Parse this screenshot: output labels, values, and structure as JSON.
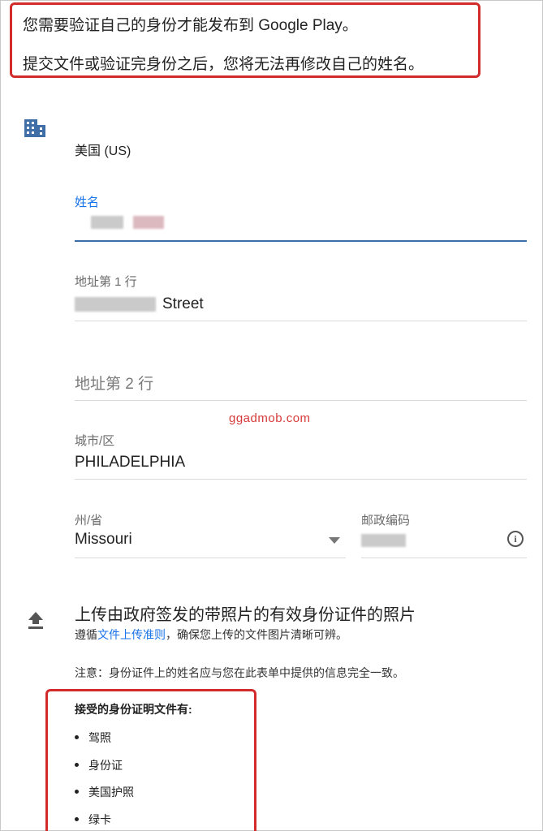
{
  "notice": {
    "line1": "您需要验证自己的身份才能发布到 Google Play。",
    "line2": "提交文件或验证完身份之后，您将无法再修改自己的姓名。"
  },
  "form": {
    "country": "美国 (US)",
    "name": {
      "label": "姓名",
      "value": ""
    },
    "address1": {
      "label": "地址第 1 行",
      "value_suffix": "Street"
    },
    "address2": {
      "placeholder": "地址第 2 行"
    },
    "city": {
      "label": "城市/区",
      "value": "PHILADELPHIA"
    },
    "state": {
      "label": "州/省",
      "value": "Missouri"
    },
    "postal": {
      "label": "邮政编码",
      "value": ""
    }
  },
  "watermark": "ggadmob.com",
  "upload": {
    "title": "上传由政府签发的带照片的有效身份证件的照片",
    "sub_prefix": "遵循",
    "sub_link": "文件上传准则",
    "sub_suffix": "，确保您上传的文件图片清晰可辨。",
    "note": "注意：身份证件上的姓名应与您在此表单中提供的信息完全一致。"
  },
  "accepted": {
    "title": "接受的身份证明文件有:",
    "items": [
      "驾照",
      "身份证",
      "美国护照",
      "绿卡"
    ]
  },
  "icons": {
    "building": "building-icon",
    "upload": "upload-icon",
    "info": "info-icon",
    "dropdown": "dropdown-arrow-icon"
  },
  "colors": {
    "accent": "#1a73e8",
    "focus_underline": "#3b6ea8",
    "highlight_box": "#d12b2b"
  }
}
